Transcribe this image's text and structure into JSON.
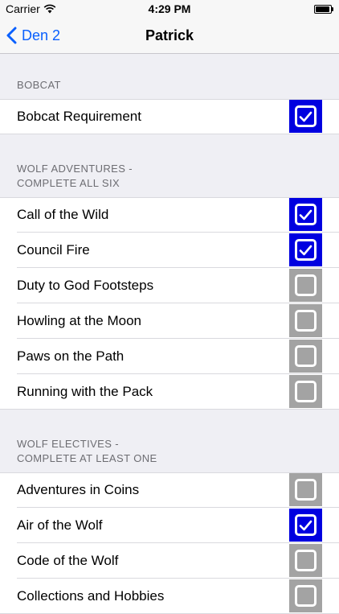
{
  "status_bar": {
    "carrier": "Carrier",
    "time": "4:29 PM"
  },
  "nav": {
    "back_label": "Den 2",
    "title": "Patrick"
  },
  "colors": {
    "checked": "#0000e0",
    "unchecked": "#a3a3a3",
    "accent": "#0a60fe"
  },
  "sections": [
    {
      "header": [
        "BOBCAT"
      ],
      "items": [
        {
          "label": "Bobcat Requirement",
          "checked": true
        }
      ]
    },
    {
      "header": [
        "WOLF ADVENTURES -",
        "COMPLETE ALL SIX"
      ],
      "items": [
        {
          "label": "Call of the Wild",
          "checked": true
        },
        {
          "label": "Council Fire",
          "checked": true
        },
        {
          "label": "Duty to God Footsteps",
          "checked": false
        },
        {
          "label": "Howling at the Moon",
          "checked": false
        },
        {
          "label": "Paws on the Path",
          "checked": false
        },
        {
          "label": "Running with the Pack",
          "checked": false
        }
      ]
    },
    {
      "header": [
        "WOLF ELECTIVES -",
        "COMPLETE AT LEAST ONE"
      ],
      "items": [
        {
          "label": "Adventures in Coins",
          "checked": false
        },
        {
          "label": "Air of the Wolf",
          "checked": true
        },
        {
          "label": "Code of the Wolf",
          "checked": false
        },
        {
          "label": "Collections and Hobbies",
          "checked": false
        }
      ]
    }
  ]
}
